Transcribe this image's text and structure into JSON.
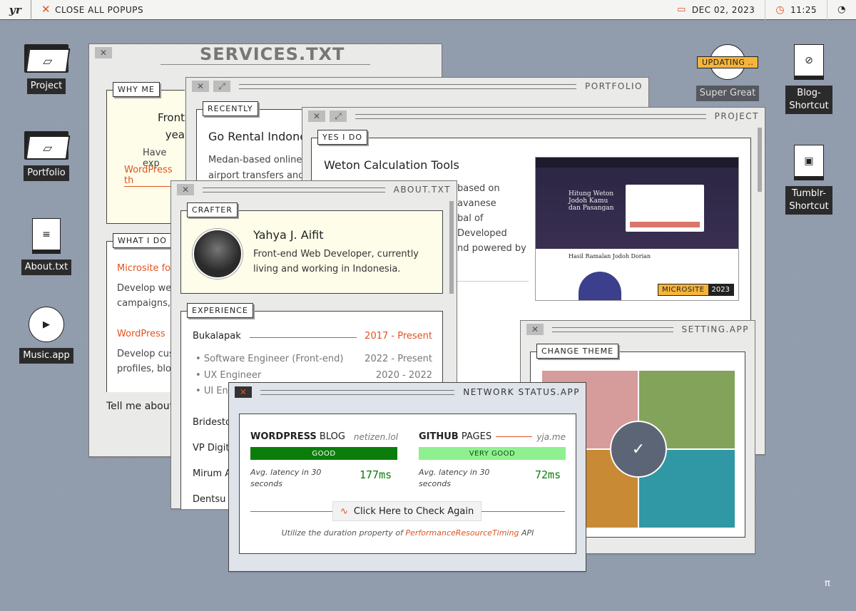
{
  "topbar": {
    "logo": "yr",
    "close_all": "CLOSE ALL POPUPS",
    "date": "DEC 02, 2023",
    "time": "11:25"
  },
  "desktop_left": [
    {
      "label": "Project",
      "icon": "folder-icon"
    },
    {
      "label": "Portfolio",
      "icon": "folder-icon"
    },
    {
      "label": "About.txt",
      "icon": "document-icon"
    },
    {
      "label": "Music.app",
      "icon": "play-icon"
    }
  ],
  "desktop_right": {
    "updating": "UPDATING ..",
    "super_great": "Super Great",
    "blog": "Blog-\nShortcut",
    "tumblr": "Tumblr-\nShortcut"
  },
  "services": {
    "title": "SERVICES.TXT",
    "why_me": "WHY ME",
    "why_text1": "Front",
    "why_text2": "yea",
    "why_text3": "Have exp",
    "why_link": "WordPress th",
    "what_i_do": "WHAT I DO",
    "item1_title": "Microsite fo",
    "item1_text1": "Develop web",
    "item1_text2": "campaigns,",
    "item2_title": "WordPress",
    "item2_text1": "Develop cus",
    "item2_text2": "profiles, blo",
    "tell_me": "Tell me about"
  },
  "portfolio": {
    "title": "PORTFOLIO",
    "recently": "RECENTLY",
    "item_title": "Go Rental Indone",
    "item_text1": "Medan-based online",
    "item_text2": "airport transfers and"
  },
  "project": {
    "title": "PROJECT",
    "tag": "YES I DO",
    "item_title": "Weton Calculation Tools",
    "desc": [
      "based on",
      "avanese",
      "bal of",
      "Developed",
      "nd powered by"
    ],
    "badge_type": "MICROSITE",
    "badge_year": "2023",
    "preview_heading": "Hitung Weton Jodoh Kamu dan Pasangan",
    "preview_result": "Hasil Ramalan Jodoh Dorian"
  },
  "about": {
    "title": "ABOUT.TXT",
    "crafter_tag": "CRAFTER",
    "name": "Yahya J. Aifit",
    "bio": "Front-end Web Developer, currently living and working in Indonesia.",
    "experience_tag": "EXPERIENCE",
    "company1": "Bukalapak",
    "company1_period": "2017 - Present",
    "roles": [
      {
        "role": "Software Engineer (Front-end)",
        "period": "2022 - Present"
      },
      {
        "role": "UX Engineer",
        "period": "2020 - 2022"
      },
      {
        "role": "UI En",
        "period": ""
      }
    ],
    "companies": [
      "Bridesto",
      "VP Digit",
      "Mirum A",
      "Dentsu I"
    ]
  },
  "setting": {
    "title": "SETTING.APP",
    "change_theme": "CHANGE THEME",
    "themes": [
      "#d69b9b",
      "#83a35a",
      "#c98a35",
      "#3097a4"
    ]
  },
  "network": {
    "title": "NETWORK STATUS.APP",
    "svc1_name_bold": "WORDPRESS",
    "svc1_name_rest": " BLOG",
    "svc1_domain": "netizen.lol",
    "svc1_status": "GOOD",
    "svc1_latency_label": "Avg. latency in 30 seconds",
    "svc1_latency": "177ms",
    "svc2_name_bold": "GITHUB",
    "svc2_name_rest": " PAGES",
    "svc2_domain": "yja.me",
    "svc2_status": "VERY GOOD",
    "svc2_latency_label": "Avg. latency in 30 seconds",
    "svc2_latency": "72ms",
    "check_button": "Click Here to Check Again",
    "footnote_pre": "Utilize the duration property of ",
    "footnote_link": "PerformanceResourceTiming",
    "footnote_post": " API"
  },
  "corner": "π"
}
